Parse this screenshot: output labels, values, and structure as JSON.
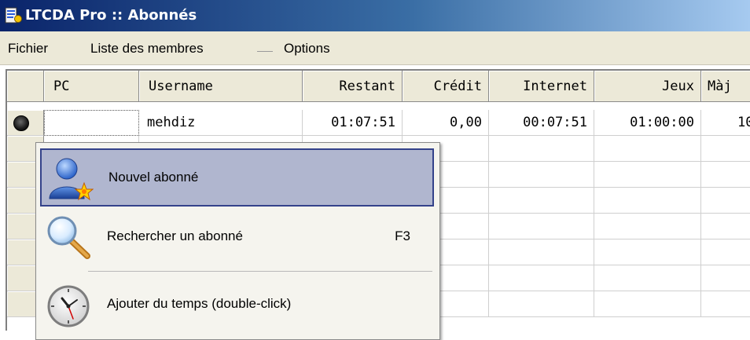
{
  "window": {
    "title": "LTCDA Pro :: Abonnés"
  },
  "menu": {
    "items": [
      "Fichier",
      "Liste des membres",
      "Options"
    ]
  },
  "grid": {
    "columns": [
      "PC",
      "Username",
      "Restant",
      "Crédit",
      "Internet",
      "Jeux",
      "Màj"
    ],
    "rows": [
      {
        "pc": "",
        "username": "mehdiz",
        "restant": "01:07:51",
        "credit": "0,00",
        "internet": "00:07:51",
        "jeux": "01:00:00",
        "maj": "10"
      }
    ]
  },
  "context_menu": {
    "items": [
      {
        "label": "Nouvel abonné",
        "shortcut": "",
        "icon": "new-user-icon",
        "highlighted": true
      },
      {
        "label": "Rechercher un abonné",
        "shortcut": "F3",
        "icon": "magnifier-icon",
        "highlighted": false
      },
      {
        "label": "Ajouter du temps (double-click)",
        "shortcut": "",
        "icon": "clock-icon",
        "highlighted": false
      }
    ]
  },
  "colors": {
    "title_bar_start": "#0a246a",
    "title_bar_end": "#a6caf0",
    "menu_highlight": "#b0b6cf",
    "menu_highlight_border": "#34428a"
  }
}
